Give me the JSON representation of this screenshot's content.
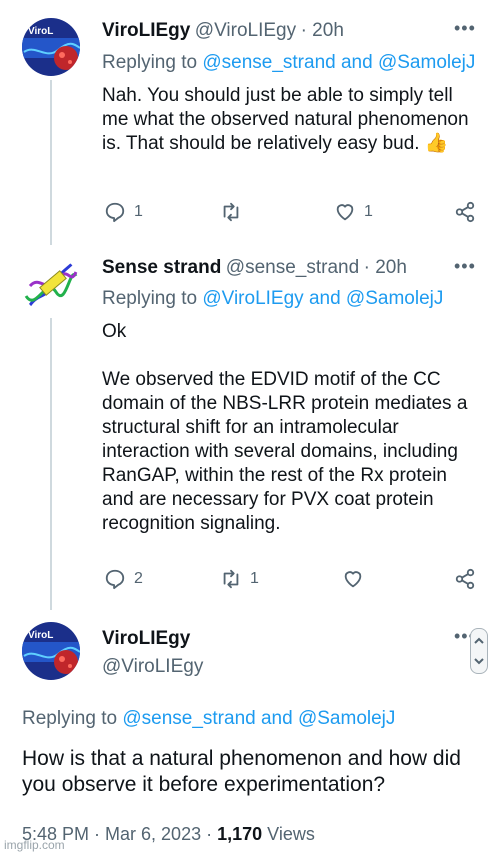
{
  "tweet1": {
    "avatar_text": "ViroL",
    "display_name": "ViroLIEgy",
    "handle": "@ViroLIEgy",
    "time": "· 20h",
    "replying_prefix": "Replying to ",
    "replying_users": "@sense_strand and @SamolejJ",
    "text": "Nah. You should just be able to simply tell me what the observed natural phenomenon is. That should be relatively easy bud. 👍",
    "reply_count": "1",
    "retweet_count": "",
    "like_count": "1"
  },
  "tweet2": {
    "display_name": "Sense strand",
    "handle": "@sense_strand",
    "time": "· 20h",
    "replying_prefix": "Replying to ",
    "replying_users": "@ViroLIEgy and @SamolejJ",
    "text": "Ok\n\nWe observed the EDVID motif of the CC domain of the NBS-LRR protein mediates a structural shift for an intramolecular interaction with several domains, including RanGAP, within the rest of the Rx protein and are necessary for PVX coat protein recognition signaling.",
    "reply_count": "2",
    "retweet_count": "1",
    "like_count": ""
  },
  "tweet3": {
    "avatar_text": "ViroL",
    "display_name": "ViroLIEgy",
    "handle": "@ViroLIEgy",
    "replying_prefix": "Replying to ",
    "replying_users": "@sense_strand and @SamolejJ",
    "text": "How is that a natural phenomenon and how did you observe it before experimentation?",
    "timestamp": "5:48 PM · Mar 6, 2023 · ",
    "views_count": "1,170",
    "views_label": " Views"
  },
  "watermark": "imgflip.com",
  "colors": {
    "link": "#1d9bf0",
    "muted": "#536471",
    "text": "#0f1419",
    "thread_line": "#cfd9de"
  }
}
